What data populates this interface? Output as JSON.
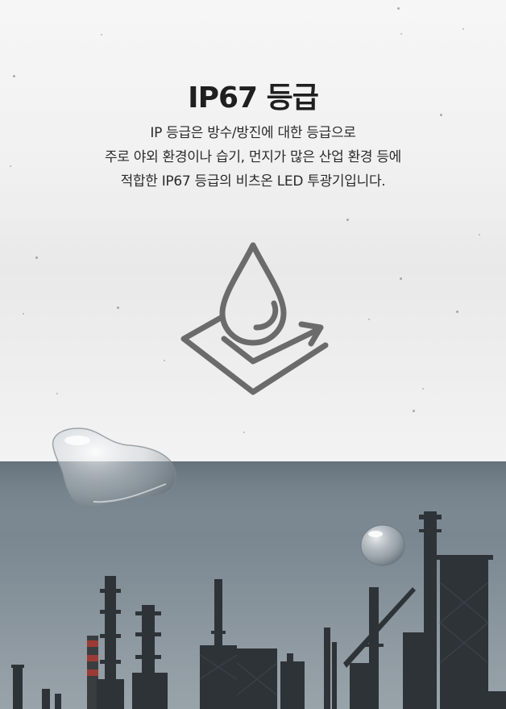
{
  "section": {
    "title": "IP67 등급",
    "description_lines": [
      "IP 등급은 방수/방진에 대한 등급으로",
      "주로 야외 환경이나 습기, 먼지가 많은 산업 환경 등에",
      "적합한 IP67 등급의 비츠온 LED 투광기입니다."
    ]
  },
  "icons": {
    "main": "water-drop-waterproof-icon"
  },
  "colors": {
    "title_text": "#1f1f1f",
    "body_text": "#2b2b2b",
    "icon_stroke": "#6b6b6b",
    "sky_top": "#6f7c86",
    "structure": "#2e3338"
  }
}
